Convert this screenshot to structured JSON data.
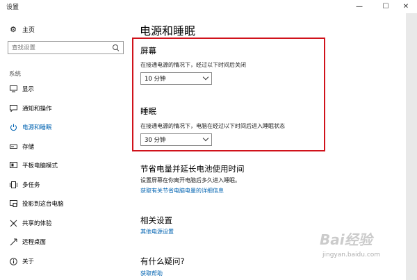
{
  "window": {
    "title": "设置",
    "minimize_glyph": "—",
    "maximize_glyph": "☐",
    "close_glyph": "✕"
  },
  "sidebar": {
    "home_label": "主页",
    "search_placeholder": "查找设置",
    "section_label": "系统",
    "items": [
      {
        "label": "显示",
        "icon": "monitor-icon"
      },
      {
        "label": "通知和操作",
        "icon": "chat-bubble-icon"
      },
      {
        "label": "电源和睡眠",
        "icon": "power-icon",
        "active": true
      },
      {
        "label": "存储",
        "icon": "storage-icon"
      },
      {
        "label": "平板电脑模式",
        "icon": "tablet-mode-icon"
      },
      {
        "label": "多任务",
        "icon": "multitask-icon"
      },
      {
        "label": "投影到这台电脑",
        "icon": "projection-icon"
      },
      {
        "label": "共享的体验",
        "icon": "shared-experiences-icon"
      },
      {
        "label": "远程桌面",
        "icon": "remote-desktop-icon"
      },
      {
        "label": "关于",
        "icon": "info-icon"
      }
    ]
  },
  "main": {
    "title": "电源和睡眠",
    "screen": {
      "heading": "屏幕",
      "description": "在接通电源的情况下，经过以下时间后关闭",
      "value": "10 分钟"
    },
    "sleep": {
      "heading": "睡眠",
      "description": "在接通电源的情况下，电脑在经过以下时间后进入睡眠状态",
      "value": "30 分钟"
    },
    "save_energy": {
      "heading": "节省电量并延长电池使用时间",
      "description": "设置屏幕在你离开电脑后多久进入睡眠。",
      "link": "获取有关节省电脑电量的详细信息"
    },
    "related": {
      "heading": "相关设置",
      "link": "其他电源设置"
    },
    "questions": {
      "heading": "有什么疑问?",
      "link": "获取帮助"
    }
  },
  "watermark": {
    "logo": "Bai经验",
    "url": "jingyan.baidu.com"
  },
  "colors": {
    "accent": "#0063b1",
    "highlight_border": "#d0121b"
  }
}
